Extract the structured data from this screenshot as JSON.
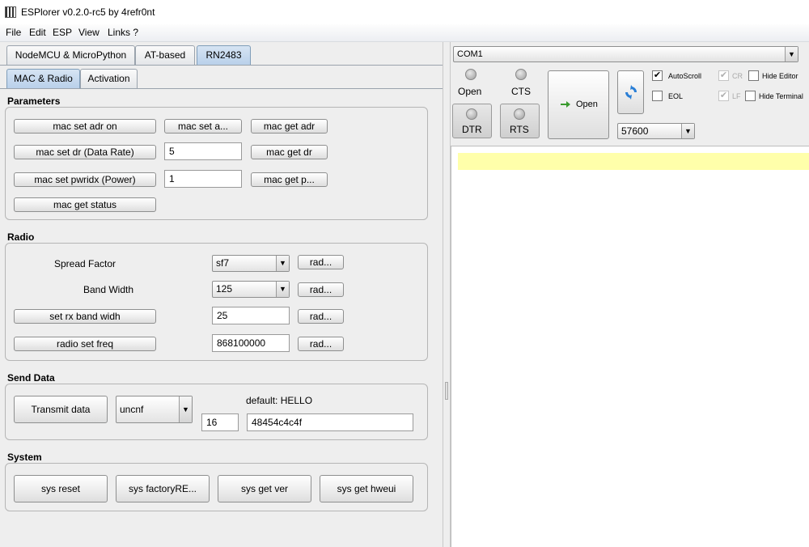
{
  "window": {
    "title": "ESPlorer v0.2.0-rc5 by 4refr0nt"
  },
  "menu": [
    "File",
    "Edit",
    "ESP",
    "View",
    "Links ?"
  ],
  "top_tabs": [
    "NodeMCU & MicroPython",
    "AT-based",
    "RN2483"
  ],
  "sub_tabs": [
    "MAC & Radio",
    "Activation"
  ],
  "parameters": {
    "title": "Parameters",
    "mac_set_adr_on": "mac set adr on",
    "mac_set_a": "mac set a...",
    "mac_get_adr": "mac get adr",
    "mac_set_dr": "mac set dr (Data Rate)",
    "dr_value": "5",
    "mac_get_dr": "mac get dr",
    "mac_set_pwridx": "mac set pwridx (Power)",
    "pwridx_value": "1",
    "mac_get_p": "mac get p...",
    "mac_get_status": "mac get status"
  },
  "radio": {
    "title": "Radio",
    "spread_factor_label": "Spread Factor",
    "spread_factor_value": "sf7",
    "band_width_label": "Band Width",
    "band_width_value": "125",
    "set_rx_band": "set rx band widh",
    "rx_band_value": "25",
    "radio_set_freq": "radio set freq",
    "freq_value": "868100000",
    "rad_button": "rad..."
  },
  "send_data": {
    "title": "Send Data",
    "transmit": "Transmit data",
    "mode_value": "uncnf",
    "default_label": "default: HELLO",
    "port_value": "16",
    "payload_value": "48454c4c4f"
  },
  "system": {
    "title": "System",
    "sys_reset": "sys reset",
    "sys_factory": "sys factoryRE...",
    "sys_get_ver": "sys get ver",
    "sys_get_hweui": "sys get hweui"
  },
  "serial": {
    "port": "COM1",
    "open_label": "Open",
    "cts_label": "CTS",
    "dtr_label": "DTR",
    "rts_label": "RTS",
    "open_button": "Open",
    "baud": "57600",
    "autoscroll": "AutoScroll",
    "cr": "CR",
    "hide_editor": "Hide Editor",
    "eol": "EOL",
    "lf": "LF",
    "hide_terminal": "Hide Terminal"
  },
  "icons": {
    "refresh": "refresh-icon",
    "open": "plug-open-icon"
  },
  "colors": {
    "active_tab": "#b9d0ea",
    "terminal_highlight": "#ffffaa",
    "refresh_icon": "#2b7fd6"
  }
}
